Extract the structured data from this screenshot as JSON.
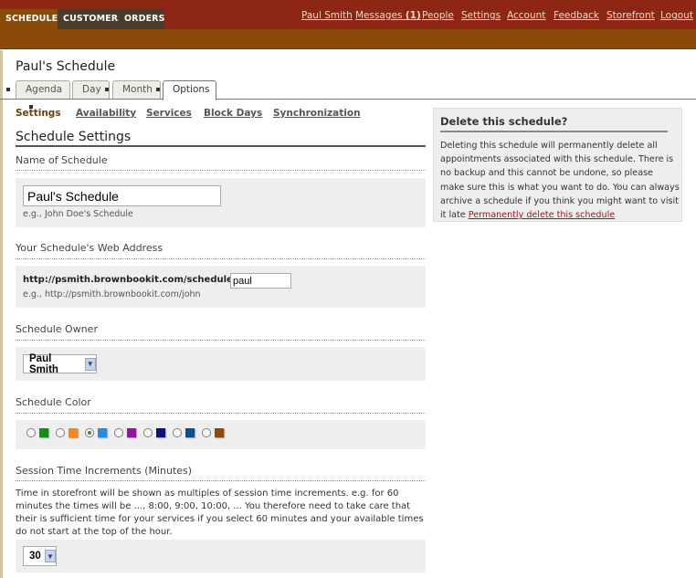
{
  "nav": {
    "tabs": [
      {
        "label": "SCHEDULES",
        "active": true
      },
      {
        "label": "CUSTOMERS"
      },
      {
        "label": "ORDERS"
      }
    ],
    "links": [
      "Paul Smith",
      "Messages",
      "(1)",
      "People",
      "Settings",
      "Account",
      "Feedback",
      "Storefront",
      "Logout"
    ]
  },
  "page": {
    "title": "Paul's Schedule"
  },
  "view_tabs": [
    {
      "label": "Agenda"
    },
    {
      "label": "Day"
    },
    {
      "label": "Month"
    },
    {
      "label": "Options",
      "active": true
    }
  ],
  "subnav": [
    {
      "label": "Settings",
      "active": true
    },
    {
      "label": "Availability"
    },
    {
      "label": "Services"
    },
    {
      "label": "Block Days"
    },
    {
      "label": "Synchronization"
    }
  ],
  "settings": {
    "heading": "Schedule Settings",
    "name": {
      "label": "Name of Schedule",
      "value": "Paul's Schedule",
      "hint": "e.g., John Doe's Schedule"
    },
    "web": {
      "label": "Your Schedule's Web Address",
      "prefix": "http://psmith.brownbookit.com/schedules/",
      "value": "paul",
      "hint": "e.g., http://psmith.brownbookit.com/john"
    },
    "owner": {
      "label": "Schedule Owner",
      "value": "Paul Smith"
    },
    "color": {
      "label": "Schedule Color",
      "options": [
        "#1a8a1a",
        "#f08a20",
        "#2a8ae0",
        "#8a1a9a",
        "#10107a",
        "#10508a",
        "#8a4a10"
      ],
      "selected_index": 2
    },
    "session": {
      "label": "Session Time Increments (Minutes)",
      "description": "Time in storefront will be shown as multiples of session time increments. e.g. for 60 minutes the times will be ..., 8:00, 9:00, 10:00, ... You therefore need to take care that their is sufficient time for your services if you select 60 minutes and your available times do not start at the top of the hour.",
      "value": "30"
    }
  },
  "delete": {
    "title": "Delete this schedule?",
    "text": "Deleting this schedule will permanently delete all appointments associated with this schedule. There is no backup and this cannot be undone, so please make sure this is what you want to do. You can always archive a schedule if you think you might want to visit it late ",
    "link": "Permanently delete this schedule"
  }
}
